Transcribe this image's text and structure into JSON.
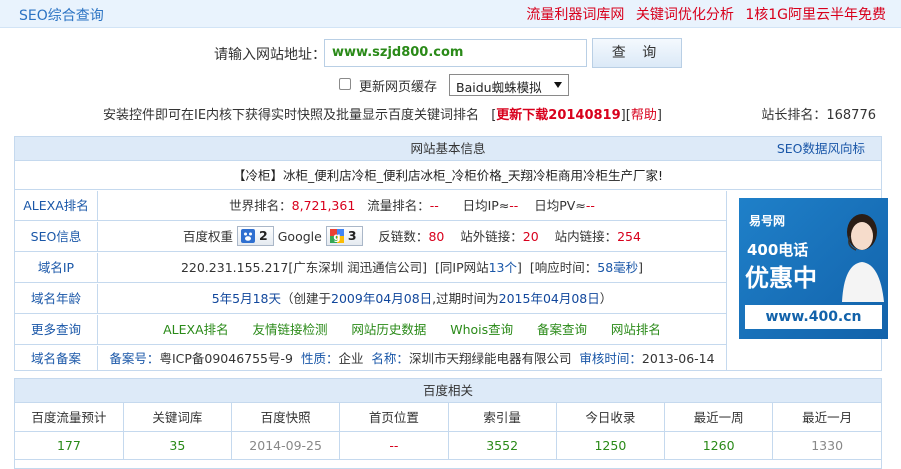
{
  "topbar": {
    "title": "SEO综合查询",
    "ads": [
      "流量利器词库网",
      "关键词优化分析",
      "1核1G阿里云半年免费"
    ]
  },
  "search": {
    "label": "请输入网站地址：",
    "value": "www.szjd800.com",
    "button": "查 询"
  },
  "options": {
    "cache_label": "更新网页缓存",
    "spider_select": "Baidu蜘蛛模拟"
  },
  "notice": {
    "text": "安装控件即可在IE内核下获得实时快照及批量显示百度关键词排名",
    "bracket_open": "[",
    "download": "更新下载20140819",
    "mid": "][",
    "help": "帮助",
    "bracket_close": "]",
    "rank_label": "站长排名：",
    "rank_value": "168776"
  },
  "basic": {
    "header": "网站基本信息",
    "header_link": "SEO数据风向标",
    "site_title": "【冷柜】冰柜_便利店冷柜_便利店冰柜_冷柜价格_天翔冷柜商用冷柜生产厂家!",
    "alexa": {
      "key": "ALEXA排名",
      "world_label": "世界排名：",
      "world_value": "8,721,361",
      "flow_label": "流量排名：",
      "flow_value": "--",
      "ip_label": "日均IP≈",
      "ip_value": "--",
      "pv_label": "日均PV≈",
      "pv_value": "--"
    },
    "seo": {
      "key": "SEO信息",
      "br_label": "百度权重",
      "br_value": "2",
      "google_label": "Google",
      "google_value": "3",
      "backlinks_label": "反链数：",
      "backlinks_value": "80",
      "outlinks_label": "站外链接：",
      "outlinks_value": "20",
      "inlinks_label": "站内链接：",
      "inlinks_value": "254"
    },
    "ip": {
      "key": "域名IP",
      "address": "220.231.155.217",
      "location": "[广东深圳 润迅通信公司]",
      "same_ip_pre": "[同IP网站",
      "same_ip_count": "13个",
      "same_ip_post": "]",
      "resp_pre": "[响应时间：",
      "resp_value": "58毫秒",
      "resp_post": "]"
    },
    "age": {
      "key": "域名年龄",
      "age": "5年5月18天",
      "created_pre": "（创建于",
      "created": "2009年04月08日",
      "expire_pre": ",过期时间为",
      "expire": "2015年04月08日",
      "close": "）"
    },
    "more": {
      "key": "更多查询",
      "links": [
        "ALEXA排名",
        "友情链接检测",
        "网站历史数据",
        "Whois查询",
        "备案查询",
        "网站排名"
      ]
    },
    "icp": {
      "key": "域名备案",
      "no_label": "备案号：",
      "no_value": "粤ICP备09046755号-9",
      "type_label": "性质：",
      "type_value": "企业",
      "name_label": "名称：",
      "name_value": "深圳市天翔绿能电器有限公司",
      "date_label": "审核时间：",
      "date_value": "2013-06-14"
    },
    "ad": {
      "brand": "易号网",
      "line1": "400电话",
      "line2": "优惠中",
      "url": "www.400.cn"
    }
  },
  "baidu": {
    "header": "百度相关",
    "columns": [
      "百度流量预计",
      "关键词库",
      "百度快照",
      "首页位置",
      "索引量",
      "今日收录",
      "最近一周",
      "最近一月"
    ],
    "values": [
      "177",
      "35",
      "2014-09-25",
      "--",
      "3552",
      "1250",
      "1260",
      "1330"
    ]
  }
}
